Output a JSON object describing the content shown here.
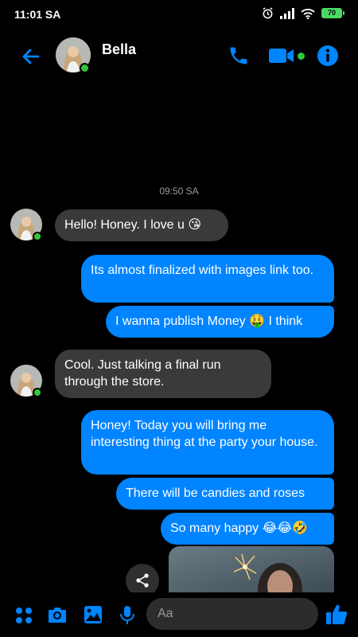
{
  "status": {
    "time": "11:01 SA",
    "battery": "70"
  },
  "header": {
    "name": "Bella"
  },
  "chat": {
    "timestamp": "09:50 SA",
    "messages": [
      {
        "dir": "in",
        "text": "Hello! Honey. I love u 😘"
      },
      {
        "dir": "out",
        "text": "Its almost finalized with images link too."
      },
      {
        "dir": "out",
        "text": "I wanna publish Money 🤑 I think"
      },
      {
        "dir": "in",
        "text": "Cool. Just talking a final run through the store."
      },
      {
        "dir": "out",
        "text": "Honey! Today you will bring me interesting thing at the party your house."
      },
      {
        "dir": "out",
        "text": "There will be candies and roses"
      },
      {
        "dir": "out",
        "text": "So many happy 😂😂🤣"
      }
    ]
  },
  "composer": {
    "placeholder": "Aa"
  },
  "colors": {
    "accent": "#0084ff",
    "online": "#31c73d",
    "incoming_bubble": "#3a3a3c"
  }
}
